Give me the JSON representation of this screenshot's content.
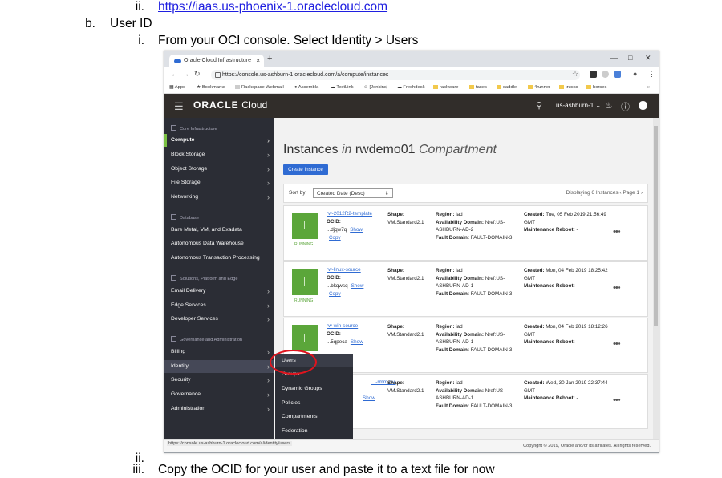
{
  "doc": {
    "line1_marker": "ii.",
    "line1_link": "https://iaas.us-phoenix-1.oraclecloud.com",
    "line2_marker": "b.",
    "line2_text": "User ID",
    "line3_marker": "i.",
    "line3_text": "From your OCI console. Select Identity > Users",
    "line4_marker": "ii.",
    "line5_marker": "iii.",
    "line5_text": "Copy the OCID for your user and paste it to a text file for now"
  },
  "browser": {
    "tab_title": "Oracle Cloud Infrastructure",
    "tab_close": "×",
    "new_tab": "+",
    "url": "https://console.us-ashburn-1.oraclecloud.com/a/compute/instances",
    "bookmarks": [
      {
        "label": "Apps"
      },
      {
        "label": "Bookmarks"
      },
      {
        "label": "Rackspace Webmail"
      },
      {
        "label": "Assembla"
      },
      {
        "label": "TestLink"
      },
      {
        "label": "[Jenkins]"
      },
      {
        "label": "Freshdesk"
      },
      {
        "label": "rackware"
      },
      {
        "label": "taxes"
      },
      {
        "label": "saddle"
      },
      {
        "label": "4runner"
      },
      {
        "label": "trucks"
      },
      {
        "label": "horses"
      }
    ],
    "bookmarks_more": "»",
    "status_url": "https://console.us-ashburn-1.oraclecloud.com/a/identity/users"
  },
  "header": {
    "logo_strong": "ORACLE",
    "logo_rest": " Cloud",
    "region": "us-ashburn-1 ⌄"
  },
  "sidebar": {
    "sections": [
      {
        "label": "Core Infrastructure"
      },
      {
        "label": "Database"
      },
      {
        "label": "Solutions, Platform and Edge"
      },
      {
        "label": "Governance and Administration"
      }
    ],
    "items": [
      {
        "label": "Compute"
      },
      {
        "label": "Block Storage"
      },
      {
        "label": "Object Storage"
      },
      {
        "label": "File Storage"
      },
      {
        "label": "Networking"
      },
      {
        "label": "Bare Metal, VM, and Exadata"
      },
      {
        "label": "Autonomous Data Warehouse"
      },
      {
        "label": "Autonomous Transaction Processing"
      },
      {
        "label": "Email Delivery"
      },
      {
        "label": "Edge Services"
      },
      {
        "label": "Developer Services"
      },
      {
        "label": "Billing"
      },
      {
        "label": "Identity"
      },
      {
        "label": "Security"
      },
      {
        "label": "Governance"
      },
      {
        "label": "Administration"
      }
    ]
  },
  "flyout": {
    "items": [
      {
        "label": "Users"
      },
      {
        "label": "Groups"
      },
      {
        "label": "Dynamic Groups"
      },
      {
        "label": "Policies"
      },
      {
        "label": "Compartments"
      },
      {
        "label": "Federation"
      }
    ]
  },
  "main": {
    "title_a": "Instances ",
    "title_in": "in",
    "title_b": " rwdemo01 ",
    "title_c": "Compartment",
    "create_button": "Create Instance",
    "sort_label": "Sort by:",
    "sort_value": "Created Date (Desc)",
    "displaying": "Displaying 6 Instances  ‹  Page 1  ›",
    "instances": [
      {
        "name": "rw-2012R2-template",
        "status": "RUNNING",
        "ocid_label": "OCID:",
        "ocid": "...djqw7q",
        "show": "Show",
        "copy": "Copy",
        "shape_label": "Shape:",
        "shape": "VM.Standard2.1",
        "region_label": "Region:",
        "region": "iad",
        "ad_label": "Availability Domain:",
        "ad": "Nref:US-ASHBURN-AD-2",
        "fd_label": "Fault Domain:",
        "fd": "FAULT-DOMAIN-3",
        "created_label": "Created:",
        "created": "Tue, 05 Feb 2019 21:56:49 GMT",
        "reboot_label": "Maintenance Reboot:",
        "reboot": "-"
      },
      {
        "name": "rw-linux-source",
        "status": "RUNNING",
        "ocid_label": "OCID:",
        "ocid": "...bkqwsq",
        "show": "Show",
        "copy": "Copy",
        "shape_label": "Shape:",
        "shape": "VM.Standard2.1",
        "region_label": "Region:",
        "region": "iad",
        "ad_label": "Availability Domain:",
        "ad": "Nref:US-ASHBURN-AD-1",
        "fd_label": "Fault Domain:",
        "fd": "FAULT-DOMAIN-3",
        "created_label": "Created:",
        "created": "Mon, 04 Feb 2019 18:25:42 GMT",
        "reboot_label": "Maintenance Reboot:",
        "reboot": "-"
      },
      {
        "name": "rw-win-source",
        "status": "",
        "ocid_label": "OCID:",
        "ocid": "...5qpeca",
        "show": "Show",
        "copy": "",
        "shape_label": "Shape:",
        "shape": "VM.Standard2.1",
        "region_label": "Region:",
        "region": "iad",
        "ad_label": "Availability Domain:",
        "ad": "Nref:US-ASHBURN-AD-1",
        "fd_label": "Fault Domain:",
        "fd": "FAULT-DOMAIN-3",
        "created_label": "Created:",
        "created": "Mon, 04 Feb 2019 18:12:26 GMT",
        "reboot_label": "Maintenance Reboot:",
        "reboot": "-"
      },
      {
        "name": "...-rmm-gui",
        "status": "",
        "ocid_label": "",
        "ocid": "",
        "show": "Show",
        "copy": "",
        "shape_label": "Shape:",
        "shape": "VM.Standard2.1",
        "region_label": "Region:",
        "region": "iad",
        "ad_label": "Availability Domain:",
        "ad": "Nref:US-ASHBURN-AD-1",
        "fd_label": "Fault Domain:",
        "fd": "FAULT-DOMAIN-3",
        "created_label": "Created:",
        "created": "Wed, 30 Jan 2019 22:37:44 GMT",
        "reboot_label": "Maintenance Reboot:",
        "reboot": "-"
      }
    ],
    "more": "•••"
  },
  "footer": {
    "copyright": "Copyright © 2019, Oracle and/or its affiliates. All rights reserved."
  },
  "colors": {
    "oci_header": "#312d2a",
    "sidebar": "#2b2d35",
    "accent_blue": "#2f6bd3",
    "running_green": "#5ba63a",
    "highlight_ring": "#e0141e",
    "doc_link": "#1f1fe0"
  }
}
